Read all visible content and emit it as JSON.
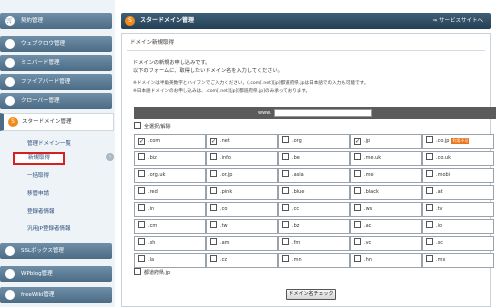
{
  "sidebar": {
    "items_top": [
      {
        "label": "契約管理",
        "icon": "cart-icon",
        "glyph": "🛒"
      },
      {
        "label": "ウェブクロウ管理",
        "icon": "web-icon",
        "glyph": "◉"
      },
      {
        "label": "ミニバード管理",
        "icon": "bird-icon",
        "glyph": "✎"
      },
      {
        "label": "ファイアバード管理",
        "icon": "fire-icon",
        "glyph": "F"
      },
      {
        "label": "クローバー管理",
        "icon": "clover-icon",
        "glyph": "✿"
      }
    ],
    "active": {
      "label": "スタードメイン管理",
      "icon": "star-domain-icon",
      "glyph": "S"
    },
    "sub_items": [
      "管理ドメイン一覧",
      "新規取得",
      "一括取得",
      "移管申請",
      "登録者情報",
      "汎用JP登録者情報"
    ],
    "items_bottom": [
      {
        "label": "SSLボックス管理",
        "icon": "ssl-icon",
        "glyph": "S"
      },
      {
        "label": "WPblog管理",
        "icon": "wp-icon",
        "glyph": "W"
      },
      {
        "label": "freeWiki管理",
        "icon": "wiki-icon",
        "glyph": "f"
      }
    ]
  },
  "header": {
    "title": "スタードメイン管理",
    "link": "⇒ サービスサイトへ"
  },
  "section_title": "ドメイン新規取得",
  "description": [
    "ドメインの新規お申し込みです。",
    "以下のフォームに、取得したいドメイン名を入力してください。"
  ],
  "notes": [
    "※ドメインは半角英数字とハイフンでご入力ください。(.com[.net][jp]都道府県.jpは日本語での入力も可能です。",
    "※日本語ドメインのお申し込みは、.com[.net][jp][都道府県.jp]のみ承っております。"
  ],
  "form": {
    "www_label": "www.",
    "domain_value": "",
    "select_all_label": "全選択/解除",
    "prefecture_label": "都道府県.jp",
    "check_button": "ドメイン名チェック",
    "badge_text": "利用不可",
    "badge_color": "#e8741c"
  },
  "tld_rows": [
    [
      {
        "name": ".com",
        "checked": true
      },
      {
        "name": ".net",
        "checked": true
      },
      {
        "name": ".org",
        "checked": false
      },
      {
        "name": ".jp",
        "checked": true
      },
      {
        "name": ".co.jp",
        "checked": false,
        "badge": true
      }
    ],
    [
      {
        "name": ".biz",
        "checked": false
      },
      {
        "name": ".info",
        "checked": false
      },
      {
        "name": ".be",
        "checked": false
      },
      {
        "name": ".me.uk",
        "checked": false
      },
      {
        "name": ".co.uk",
        "checked": false
      }
    ],
    [
      {
        "name": ".org.uk",
        "checked": false
      },
      {
        "name": ".or.jp",
        "checked": false
      },
      {
        "name": ".asia",
        "checked": false
      },
      {
        "name": ".me",
        "checked": false
      },
      {
        "name": ".mobi",
        "checked": false
      }
    ],
    [
      {
        "name": ".red",
        "checked": false
      },
      {
        "name": ".pink",
        "checked": false
      },
      {
        "name": ".blue",
        "checked": false
      },
      {
        "name": ".black",
        "checked": false
      },
      {
        "name": ".at",
        "checked": false
      }
    ],
    [
      {
        "name": ".in",
        "checked": false
      },
      {
        "name": ".co",
        "checked": false
      },
      {
        "name": ".cc",
        "checked": false
      },
      {
        "name": ".ws",
        "checked": false
      },
      {
        "name": ".tv",
        "checked": false
      }
    ],
    [
      {
        "name": ".cm",
        "checked": false
      },
      {
        "name": ".tw",
        "checked": false
      },
      {
        "name": ".bz",
        "checked": false
      },
      {
        "name": ".ac",
        "checked": false
      },
      {
        "name": ".io",
        "checked": false
      }
    ],
    [
      {
        "name": ".sh",
        "checked": false
      },
      {
        "name": ".am",
        "checked": false
      },
      {
        "name": ".fm",
        "checked": false
      },
      {
        "name": ".vc",
        "checked": false
      },
      {
        "name": ".sc",
        "checked": false
      }
    ],
    [
      {
        "name": ".la",
        "checked": false
      },
      {
        "name": ".cz",
        "checked": false
      },
      {
        "name": ".mn",
        "checked": false
      },
      {
        "name": ".hn",
        "checked": false
      },
      {
        "name": ".mx",
        "checked": false
      }
    ]
  ],
  "colors": {
    "header": "#2f4c63",
    "nav": "#5a7a93",
    "accent": "#f08a1c",
    "selected_border": "#d92020"
  }
}
